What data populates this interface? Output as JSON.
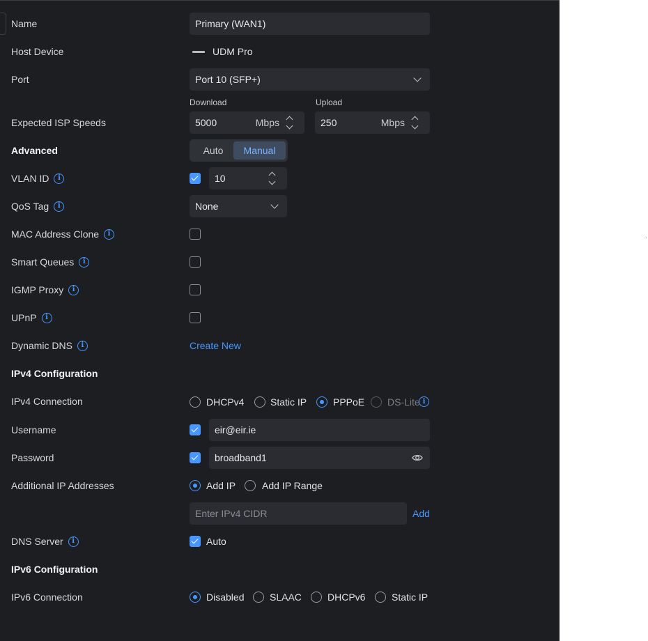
{
  "labels": {
    "name": "Name",
    "host_device": "Host Device",
    "port": "Port",
    "expected_isp_speeds": "Expected ISP Speeds",
    "advanced": "Advanced",
    "vlan_id": "VLAN ID",
    "qos_tag": "QoS Tag",
    "mac_clone": "MAC Address Clone",
    "smart_queues": "Smart Queues",
    "igmp_proxy": "IGMP Proxy",
    "upnp": "UPnP",
    "dynamic_dns": "Dynamic DNS",
    "ipv4_config": "IPv4 Configuration",
    "ipv4_connection": "IPv4 Connection",
    "username": "Username",
    "password": "Password",
    "additional_ip": "Additional IP Addresses",
    "dns_server": "DNS Server",
    "ipv6_config": "IPv6 Configuration",
    "ipv6_connection": "IPv6 Connection"
  },
  "name_value": "Primary (WAN1)",
  "host_device_value": "UDM Pro",
  "port_value": "Port 10 (SFP+)",
  "download": {
    "caption": "Download",
    "value": "5000",
    "unit": "Mbps"
  },
  "upload": {
    "caption": "Upload",
    "value": "250",
    "unit": "Mbps"
  },
  "advanced_mode": {
    "auto": "Auto",
    "manual": "Manual",
    "selected": "Manual"
  },
  "vlan": {
    "enabled": true,
    "value": "10"
  },
  "qos_value": "None",
  "checkboxes": {
    "mac_clone": false,
    "smart_queues": false,
    "igmp_proxy": false,
    "upnp": false
  },
  "dynamic_dns_link": "Create New",
  "ipv4_options": [
    "DHCPv4",
    "Static IP",
    "PPPoE",
    "DS-Lite"
  ],
  "ipv4_selected": "PPPoE",
  "username_value": "eir@eir.ie",
  "password_value": "broadband1",
  "additional_ip": {
    "add_ip": "Add IP",
    "add_ip_range": "Add IP Range",
    "selected": "Add IP",
    "placeholder": "Enter IPv4 CIDR",
    "add_link": "Add"
  },
  "dns_auto_label": "Auto",
  "ipv6_options": [
    "Disabled",
    "SLAAC",
    "DHCPv6",
    "Static IP"
  ],
  "ipv6_selected": "Disabled",
  "colors": {
    "panel": "#1c1e22",
    "field": "#2a2c31",
    "accent": "#4797ff"
  }
}
